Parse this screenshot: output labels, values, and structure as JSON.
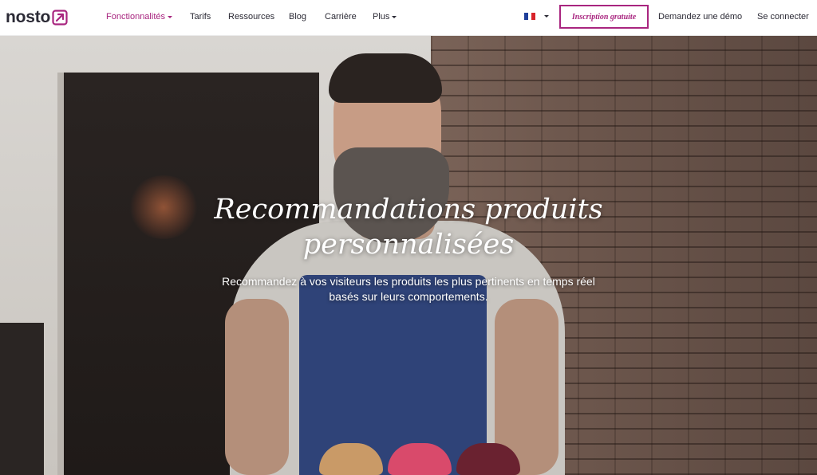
{
  "brand": {
    "name": "nosto",
    "accent_color": "#a8257f",
    "logo_icon": "arrow-box-icon"
  },
  "nav": {
    "items": [
      {
        "label": "Fonctionnalités",
        "dropdown": true,
        "active": true
      },
      {
        "label": "Tarifs",
        "dropdown": false,
        "active": false
      },
      {
        "label": "Ressources",
        "dropdown": false,
        "active": false
      },
      {
        "label": "Blog",
        "dropdown": false,
        "active": false
      },
      {
        "label": "Carrière",
        "dropdown": false,
        "active": false
      },
      {
        "label": "Plus",
        "dropdown": true,
        "active": false
      }
    ],
    "language_icon": "france-flag-icon",
    "signup_label": "Inscription gratuite",
    "demo_label": "Demandez une démo",
    "login_label": "Se connecter"
  },
  "hero": {
    "title_line1": "Recommandations produits",
    "title_line2": "personnalisées",
    "subtitle_line1": "Recommandez à vos visiteurs les produits les plus pertinents en temps réel",
    "subtitle_line2": "basés sur leurs comportements."
  }
}
